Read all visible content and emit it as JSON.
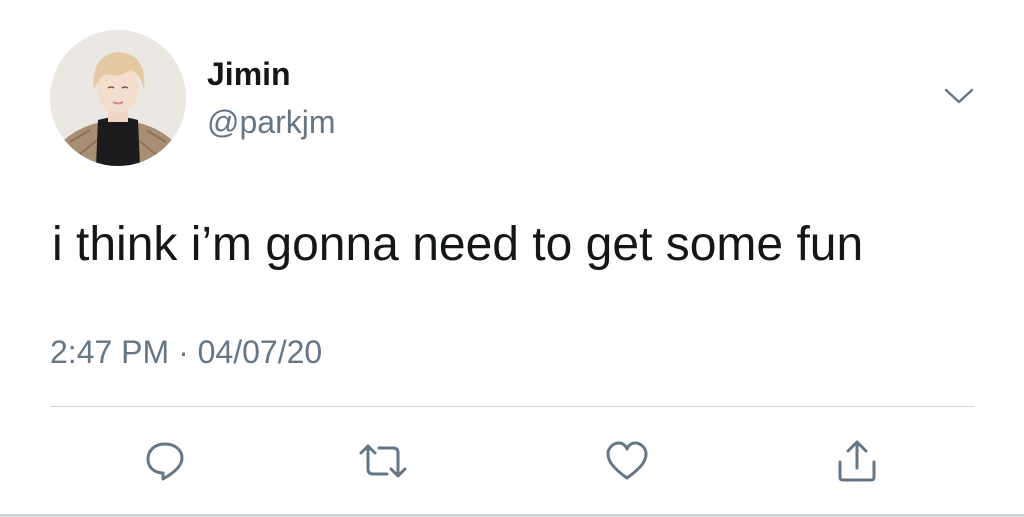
{
  "tweet": {
    "author": {
      "display_name": "Jimin",
      "handle": "@parkjm",
      "avatar_icon": "profile-photo-avatar"
    },
    "text": "i think i’m gonna need to get some fun",
    "timestamp": {
      "time": "2:47 PM",
      "separator": "·",
      "date": "04/07/20"
    },
    "menu_icon": "chevron-down-icon",
    "actions": [
      {
        "name": "reply",
        "icon": "reply-icon"
      },
      {
        "name": "retweet",
        "icon": "retweet-icon"
      },
      {
        "name": "like",
        "icon": "heart-icon"
      },
      {
        "name": "share",
        "icon": "share-icon"
      }
    ]
  },
  "colors": {
    "text_primary": "#14171a",
    "text_secondary": "#657786",
    "icon": "#657786",
    "divider": "#ccd6dd",
    "background": "#ffffff"
  }
}
